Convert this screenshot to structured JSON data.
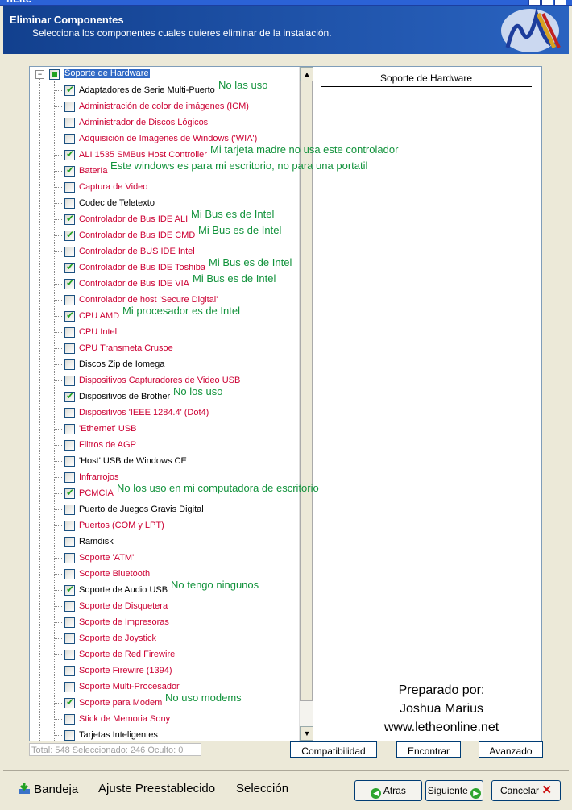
{
  "window": {
    "title": "nLite"
  },
  "header": {
    "title": "Eliminar Componentes",
    "subtitle": "Selecciona los componentes cuales quieres eliminar de la instalación."
  },
  "tree": {
    "root": "Soporte de Hardware",
    "items": [
      {
        "label": "Adaptadores de Serie Multi-Puerto",
        "checked": true,
        "red": false,
        "note": "No las uso"
      },
      {
        "label": "Administración de color de imágenes (ICM)",
        "checked": false,
        "red": true,
        "note": ""
      },
      {
        "label": "Administrador de Discos Lógicos",
        "checked": false,
        "red": true,
        "note": ""
      },
      {
        "label": "Adquisición de Imágenes de Windows ('WIA')",
        "checked": false,
        "red": true,
        "note": ""
      },
      {
        "label": "ALI 1535 SMBus Host Controller",
        "checked": true,
        "red": true,
        "note": "Mi tarjeta madre no usa este controlador"
      },
      {
        "label": "Batería",
        "checked": true,
        "red": true,
        "note": "Este windows es para mi escritorio, no para una portatil"
      },
      {
        "label": "Captura de Video",
        "checked": false,
        "red": true,
        "note": ""
      },
      {
        "label": "Codec de Teletexto",
        "checked": false,
        "red": false,
        "note": ""
      },
      {
        "label": "Controlador de Bus IDE ALI",
        "checked": true,
        "red": true,
        "note": "Mi Bus es de Intel"
      },
      {
        "label": "Controlador de Bus IDE CMD",
        "checked": true,
        "red": true,
        "note": "Mi Bus es de Intel"
      },
      {
        "label": "Controlador de BUS IDE Intel",
        "checked": false,
        "red": true,
        "note": ""
      },
      {
        "label": "Controlador de Bus IDE Toshiba",
        "checked": true,
        "red": true,
        "note": "Mi Bus es de Intel"
      },
      {
        "label": "Controlador de Bus IDE VIA",
        "checked": true,
        "red": true,
        "note": "Mi Bus es de Intel"
      },
      {
        "label": "Controlador de host 'Secure Digital'",
        "checked": false,
        "red": true,
        "note": ""
      },
      {
        "label": "CPU AMD",
        "checked": true,
        "red": true,
        "note": "Mi procesador es de Intel"
      },
      {
        "label": "CPU Intel",
        "checked": false,
        "red": true,
        "note": ""
      },
      {
        "label": "CPU Transmeta Crusoe",
        "checked": false,
        "red": true,
        "note": ""
      },
      {
        "label": "Discos Zip de Iomega",
        "checked": false,
        "red": false,
        "note": ""
      },
      {
        "label": "Dispositivos Capturadores de Video USB",
        "checked": false,
        "red": true,
        "note": ""
      },
      {
        "label": "Dispositivos de Brother",
        "checked": true,
        "red": false,
        "note": "No los uso"
      },
      {
        "label": "Dispositivos 'IEEE 1284.4' (Dot4)",
        "checked": false,
        "red": true,
        "note": ""
      },
      {
        "label": "'Ethernet' USB",
        "checked": false,
        "red": true,
        "note": ""
      },
      {
        "label": "Filtros de AGP",
        "checked": false,
        "red": true,
        "note": ""
      },
      {
        "label": "'Host' USB de Windows CE",
        "checked": false,
        "red": false,
        "note": ""
      },
      {
        "label": "Infrarrojos",
        "checked": false,
        "red": true,
        "note": ""
      },
      {
        "label": "PCMCIA",
        "checked": true,
        "red": true,
        "note": "No los uso en mi computadora de escritorio"
      },
      {
        "label": "Puerto de Juegos Gravis Digital",
        "checked": false,
        "red": false,
        "note": ""
      },
      {
        "label": "Puertos (COM y LPT)",
        "checked": false,
        "red": true,
        "note": ""
      },
      {
        "label": "Ramdisk",
        "checked": false,
        "red": false,
        "note": ""
      },
      {
        "label": "Soporte 'ATM'",
        "checked": false,
        "red": true,
        "note": ""
      },
      {
        "label": "Soporte Bluetooth",
        "checked": false,
        "red": true,
        "note": ""
      },
      {
        "label": "Soporte de Audio USB",
        "checked": true,
        "red": false,
        "note": "No tengo ningunos"
      },
      {
        "label": "Soporte de Disquetera",
        "checked": false,
        "red": true,
        "note": ""
      },
      {
        "label": "Soporte de Impresoras",
        "checked": false,
        "red": true,
        "note": ""
      },
      {
        "label": "Soporte de Joystick",
        "checked": false,
        "red": true,
        "note": ""
      },
      {
        "label": "Soporte de Red Firewire",
        "checked": false,
        "red": true,
        "note": ""
      },
      {
        "label": "Soporte Firewire (1394)",
        "checked": false,
        "red": true,
        "note": ""
      },
      {
        "label": "Soporte Multi-Procesador",
        "checked": false,
        "red": true,
        "note": ""
      },
      {
        "label": "Soporte para Modem",
        "checked": true,
        "red": true,
        "note": "No uso modems"
      },
      {
        "label": "Stick de Memoria Sony",
        "checked": false,
        "red": true,
        "note": ""
      },
      {
        "label": "Tarjetas Inteligentes",
        "checked": false,
        "red": false,
        "note": ""
      }
    ]
  },
  "right_panel": {
    "heading": "Soporte de Hardware"
  },
  "credit": {
    "line1": "Preparado por:",
    "line2": "Joshua Marius",
    "line3": "www.letheonline.net"
  },
  "status": "Total: 548 Seleccionado: 246 Oculto: 0",
  "buttons": {
    "compat": "Compatibilidad",
    "find": "Encontrar",
    "advanced": "Avanzado"
  },
  "bottom": {
    "tray": "Bandeja",
    "preset": "Ajuste Preestablecido",
    "selection": "Selección",
    "back": "Atras",
    "next": "Siguiente",
    "cancel": "Cancelar"
  },
  "colors": {
    "header_bg": "#1b4fa5",
    "item_red": "#cc0033",
    "note_green": "#11923b",
    "check_green": "#21a121"
  }
}
